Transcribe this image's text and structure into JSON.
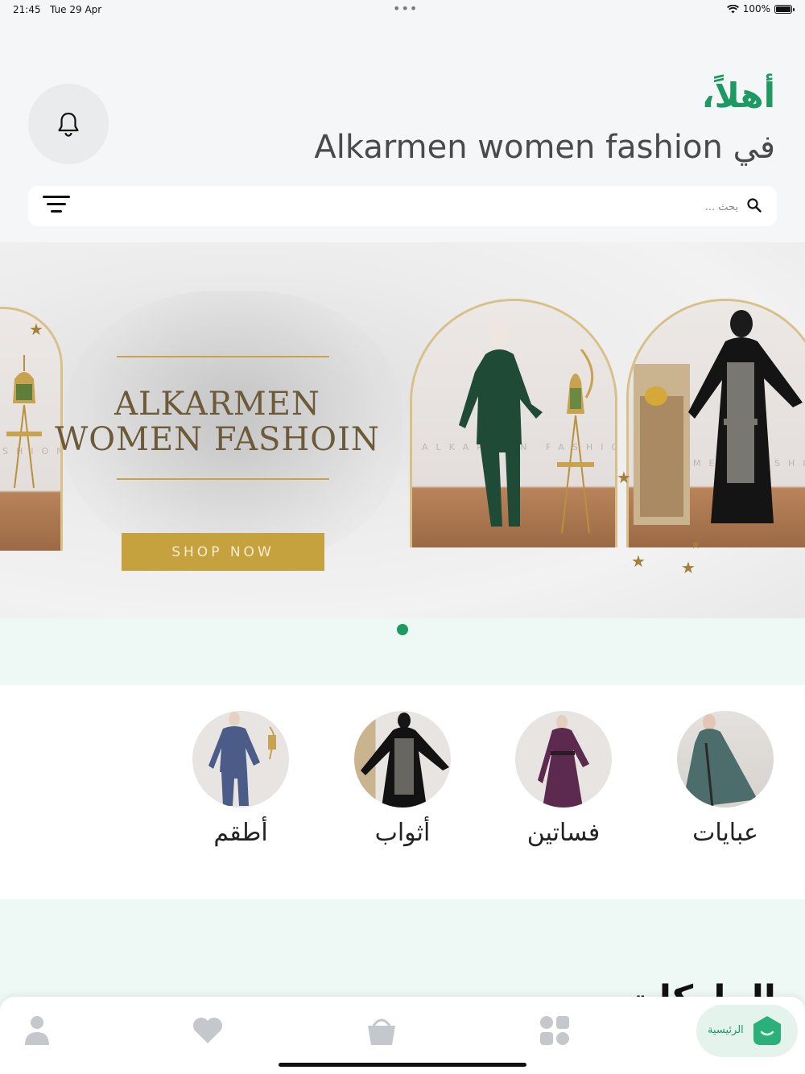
{
  "status_bar": {
    "time": "21:45",
    "date": "Tue 29 Apr",
    "battery": "100%",
    "battery_level": 1.0
  },
  "header": {
    "welcome": "أهلاً،",
    "subtitle": "في Alkarmen women fashion"
  },
  "search": {
    "placeholder": "بحث ..."
  },
  "banner": {
    "title_line1": "ALKARMEN",
    "title_line2": "WOMEN FASHOIN",
    "button": "SHOP NOW",
    "watermark_left": "SHION",
    "watermark_mid": "ALKARMEN FASHION",
    "watermark_right": "MEN FASHI",
    "pages": 1,
    "active_page": 1
  },
  "categories": [
    {
      "label": "عبايات",
      "icon": "abaya-photo"
    },
    {
      "label": "فساتين",
      "icon": "dress-photo"
    },
    {
      "label": "أثواب",
      "icon": "thobe-photo"
    },
    {
      "label": "أطقم",
      "icon": "set-photo"
    }
  ],
  "sections": {
    "brands_title": "الماركات"
  },
  "bottom_nav": {
    "home_label": "الرئيسية",
    "items": [
      "profile-icon",
      "heart-icon",
      "basket-icon",
      "grid-icon",
      "home-icon"
    ]
  },
  "colors": {
    "accent": "#1d9a62",
    "gold": "#c6a23f",
    "mint": "#eef8f4"
  }
}
